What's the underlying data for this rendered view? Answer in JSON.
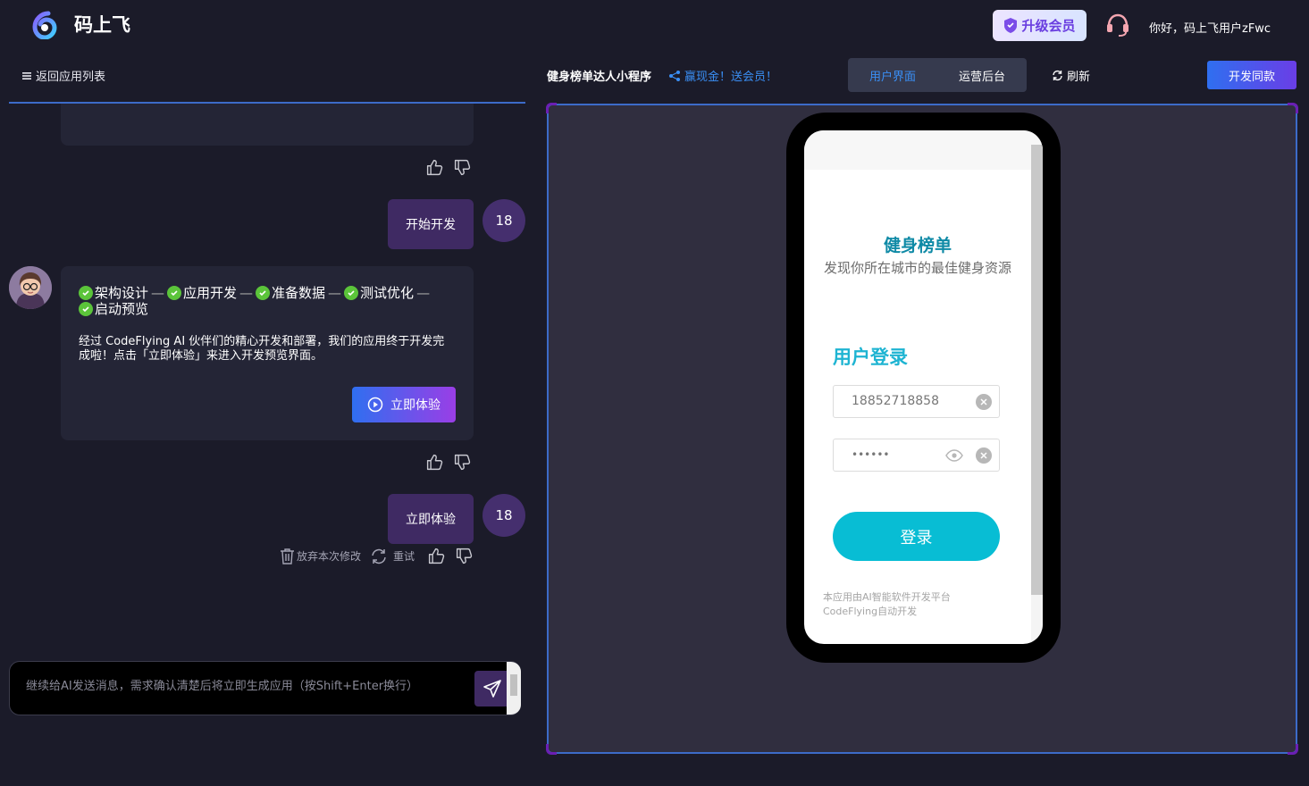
{
  "header": {
    "brand": "码上飞",
    "upgrade_label": "升级会员",
    "greeting": "你好，码上飞用户zFwc"
  },
  "left": {
    "back_label": "返回应用列表",
    "messages": [
      {
        "role": "user",
        "text": "开始开发",
        "avatar": "18"
      },
      {
        "role": "user",
        "text": "立即体验",
        "avatar": "18"
      }
    ],
    "steps": [
      "架构设计",
      "应用开发",
      "准备数据",
      "测试优化",
      "启动预览"
    ],
    "ai_text": "经过 CodeFlying AI 伙伴们的精心开发和部署，我们的应用终于开发完成啦！点击「立即体验」来进入开发预览界面。",
    "try_label": "立即体验",
    "discard_label": "放弃本次修改",
    "retry_label": "重试",
    "input_placeholder": "继续给AI发送消息，需求确认清楚后将立即生成应用（按Shift+Enter换行）"
  },
  "toolbar": {
    "app_title": "健身榜单达人小程序",
    "share_label": "赢现金！送会员！",
    "tabs": [
      {
        "label": "用户界面",
        "active": true
      },
      {
        "label": "运营后台",
        "active": false
      }
    ],
    "refresh_label": "刷新",
    "dev_label": "开发同款"
  },
  "mobile": {
    "title": "健身榜单",
    "subtitle": "发现你所在城市的最佳健身资源",
    "login_heading": "用户登录",
    "phone_value": "18852718858",
    "password_mask": "••••••",
    "login_button": "登录",
    "footer": "本应用由AI智能软件开发平台CodeFlying自动开发"
  },
  "colors": {
    "accent_blue": "#3a8ff5",
    "accent_purple": "#6a3ee6",
    "teal": "#08bdd4",
    "check_green": "#5bc43a"
  }
}
